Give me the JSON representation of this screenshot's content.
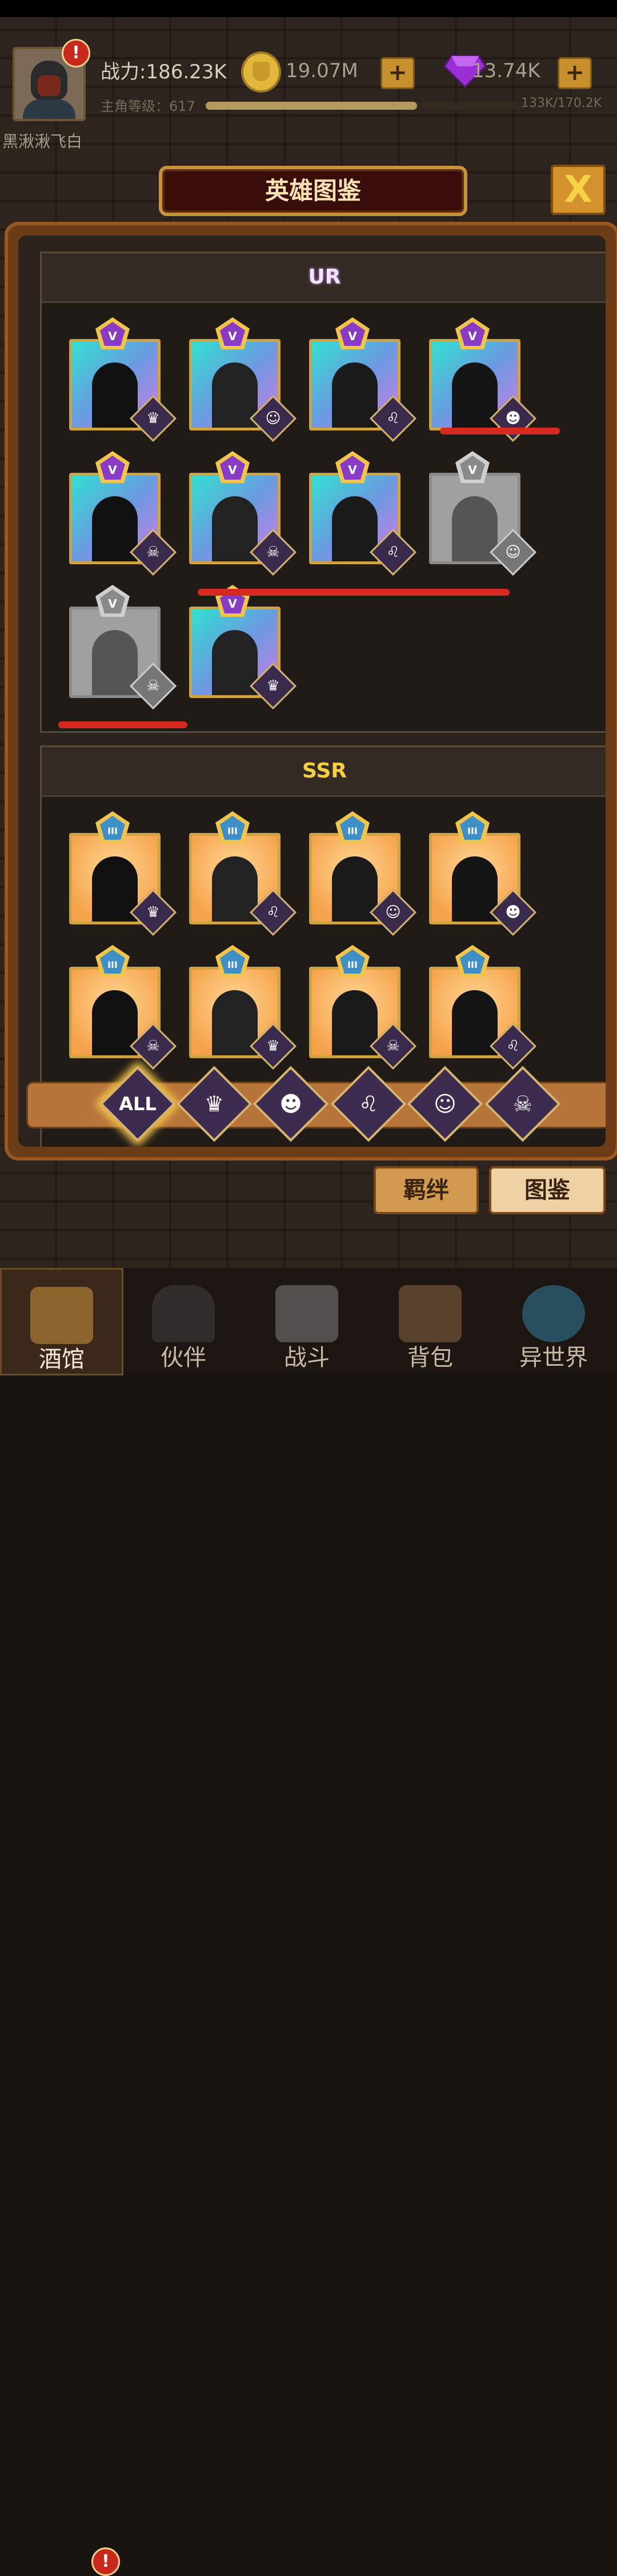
{
  "player": {
    "name": "黑湫湫飞白",
    "power": "战力:186.23K",
    "level": "主角等级：617",
    "xp": "133K/170.2K",
    "xp_fraction": 0.66
  },
  "currency": {
    "gold": "19.07M",
    "gems": "13.74K",
    "plus": "+"
  },
  "alert": "!",
  "title": "英雄图鉴",
  "close": "X",
  "sections": {
    "ur": "UR",
    "ssr": "SSR"
  },
  "badges": {
    "ur_rank": "V",
    "ssr_rank": "III"
  },
  "filters": {
    "all": "ALL",
    "icons": [
      "knight-icon",
      "elf-icon",
      "beast-icon",
      "human-icon",
      "demon-icon"
    ]
  },
  "subtabs": {
    "bond": "羁绊",
    "codex": "图鉴"
  },
  "nav": [
    "酒馆",
    "伙伴",
    "战斗",
    "背包",
    "异世界"
  ],
  "colors": {
    "accent_gold": "#d0a341",
    "ur_gradient": [
      "#33e0d1",
      "#d07ce8"
    ],
    "ssr_bg": "#f6a24a",
    "alert_red": "#c8291d",
    "mark_red": "#d7291f"
  },
  "ur_heroes": [
    {
      "state": "owned",
      "class": "knight-icon"
    },
    {
      "state": "owned",
      "class": "human-icon"
    },
    {
      "state": "owned",
      "class": "beast-icon"
    },
    {
      "state": "owned",
      "class": "elf-icon"
    },
    {
      "state": "owned",
      "class": "demon-icon"
    },
    {
      "state": "owned",
      "class": "demon-icon"
    },
    {
      "state": "owned",
      "class": "beast-icon"
    },
    {
      "state": "locked",
      "class": "human-icon"
    },
    {
      "state": "locked",
      "class": "demon-icon"
    },
    {
      "state": "owned",
      "class": "knight-icon"
    }
  ],
  "ssr_heroes": [
    {
      "state": "owned",
      "class": "knight-icon"
    },
    {
      "state": "owned",
      "class": "beast-icon"
    },
    {
      "state": "owned",
      "class": "human-icon"
    },
    {
      "state": "owned",
      "class": "elf-icon"
    },
    {
      "state": "owned",
      "class": "demon-icon"
    },
    {
      "state": "owned",
      "class": "knight-icon"
    },
    {
      "state": "owned",
      "class": "demon-icon"
    },
    {
      "state": "owned",
      "class": "beast-icon"
    }
  ]
}
